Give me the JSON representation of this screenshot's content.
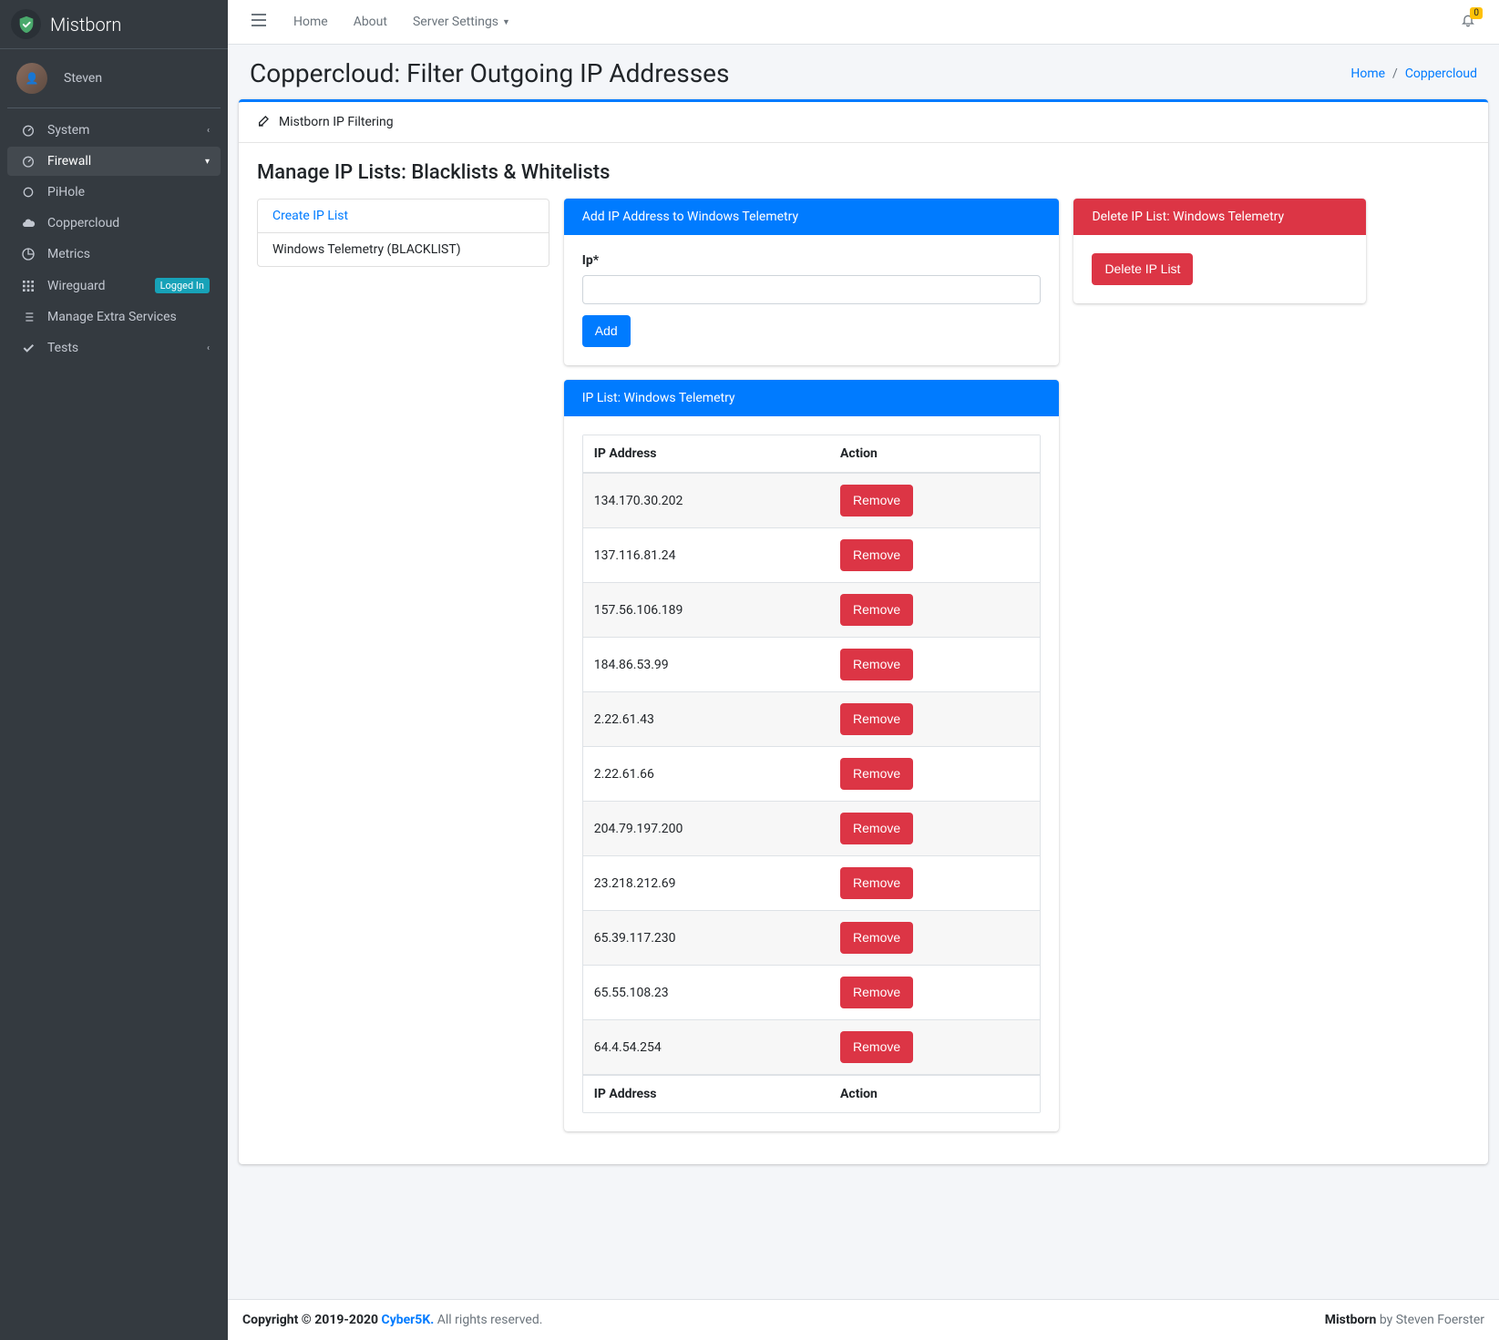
{
  "brand": {
    "name": "Mistborn"
  },
  "user": {
    "name": "Steven"
  },
  "sidebar": {
    "items": [
      {
        "label": "System",
        "icon": "gauge",
        "caret": true
      },
      {
        "label": "Firewall",
        "icon": "gauge",
        "caret": true,
        "active": true
      },
      {
        "label": "PiHole",
        "icon": "circle"
      },
      {
        "label": "Coppercloud",
        "icon": "cloud"
      },
      {
        "label": "Metrics",
        "icon": "pie"
      },
      {
        "label": "Wireguard",
        "icon": "grid",
        "badge": "Logged In"
      },
      {
        "label": "Manage Extra Services",
        "icon": "list"
      },
      {
        "label": "Tests",
        "icon": "check",
        "caret": true
      }
    ]
  },
  "topnav": {
    "links": [
      "Home",
      "About",
      "Server Settings"
    ],
    "notifications": "0"
  },
  "header": {
    "title": "Coppercloud: Filter Outgoing IP Addresses",
    "breadcrumb": [
      {
        "label": "Home",
        "link": true
      },
      {
        "label": "Coppercloud",
        "link": true
      }
    ]
  },
  "panel": {
    "title": "Mistborn IP Filtering",
    "section_title": "Manage IP Lists: Blacklists & Whitelists",
    "list_nav": [
      {
        "label": "Create IP List",
        "link": true
      },
      {
        "label": "Windows Telemetry (BLACKLIST)"
      }
    ],
    "add_card": {
      "title": "Add IP Address to Windows Telemetry",
      "ip_label": "Ip*",
      "button": "Add"
    },
    "delete_card": {
      "title": "Delete IP List: Windows Telemetry",
      "button": "Delete IP List"
    },
    "ip_list": {
      "title": "IP List: Windows Telemetry",
      "headers": {
        "ip": "IP Address",
        "action": "Action"
      },
      "remove_label": "Remove",
      "rows": [
        "134.170.30.202",
        "137.116.81.24",
        "157.56.106.189",
        "184.86.53.99",
        "2.22.61.43",
        "2.22.61.66",
        "204.79.197.200",
        "23.218.212.69",
        "65.39.117.230",
        "65.55.108.23",
        "64.4.54.254"
      ]
    }
  },
  "footer": {
    "copyright_prefix": "Copyright © 2019-2020 ",
    "company": "Cyber5K.",
    "rights": " All rights reserved.",
    "app": "Mistborn",
    "by": " by Steven Foerster"
  }
}
